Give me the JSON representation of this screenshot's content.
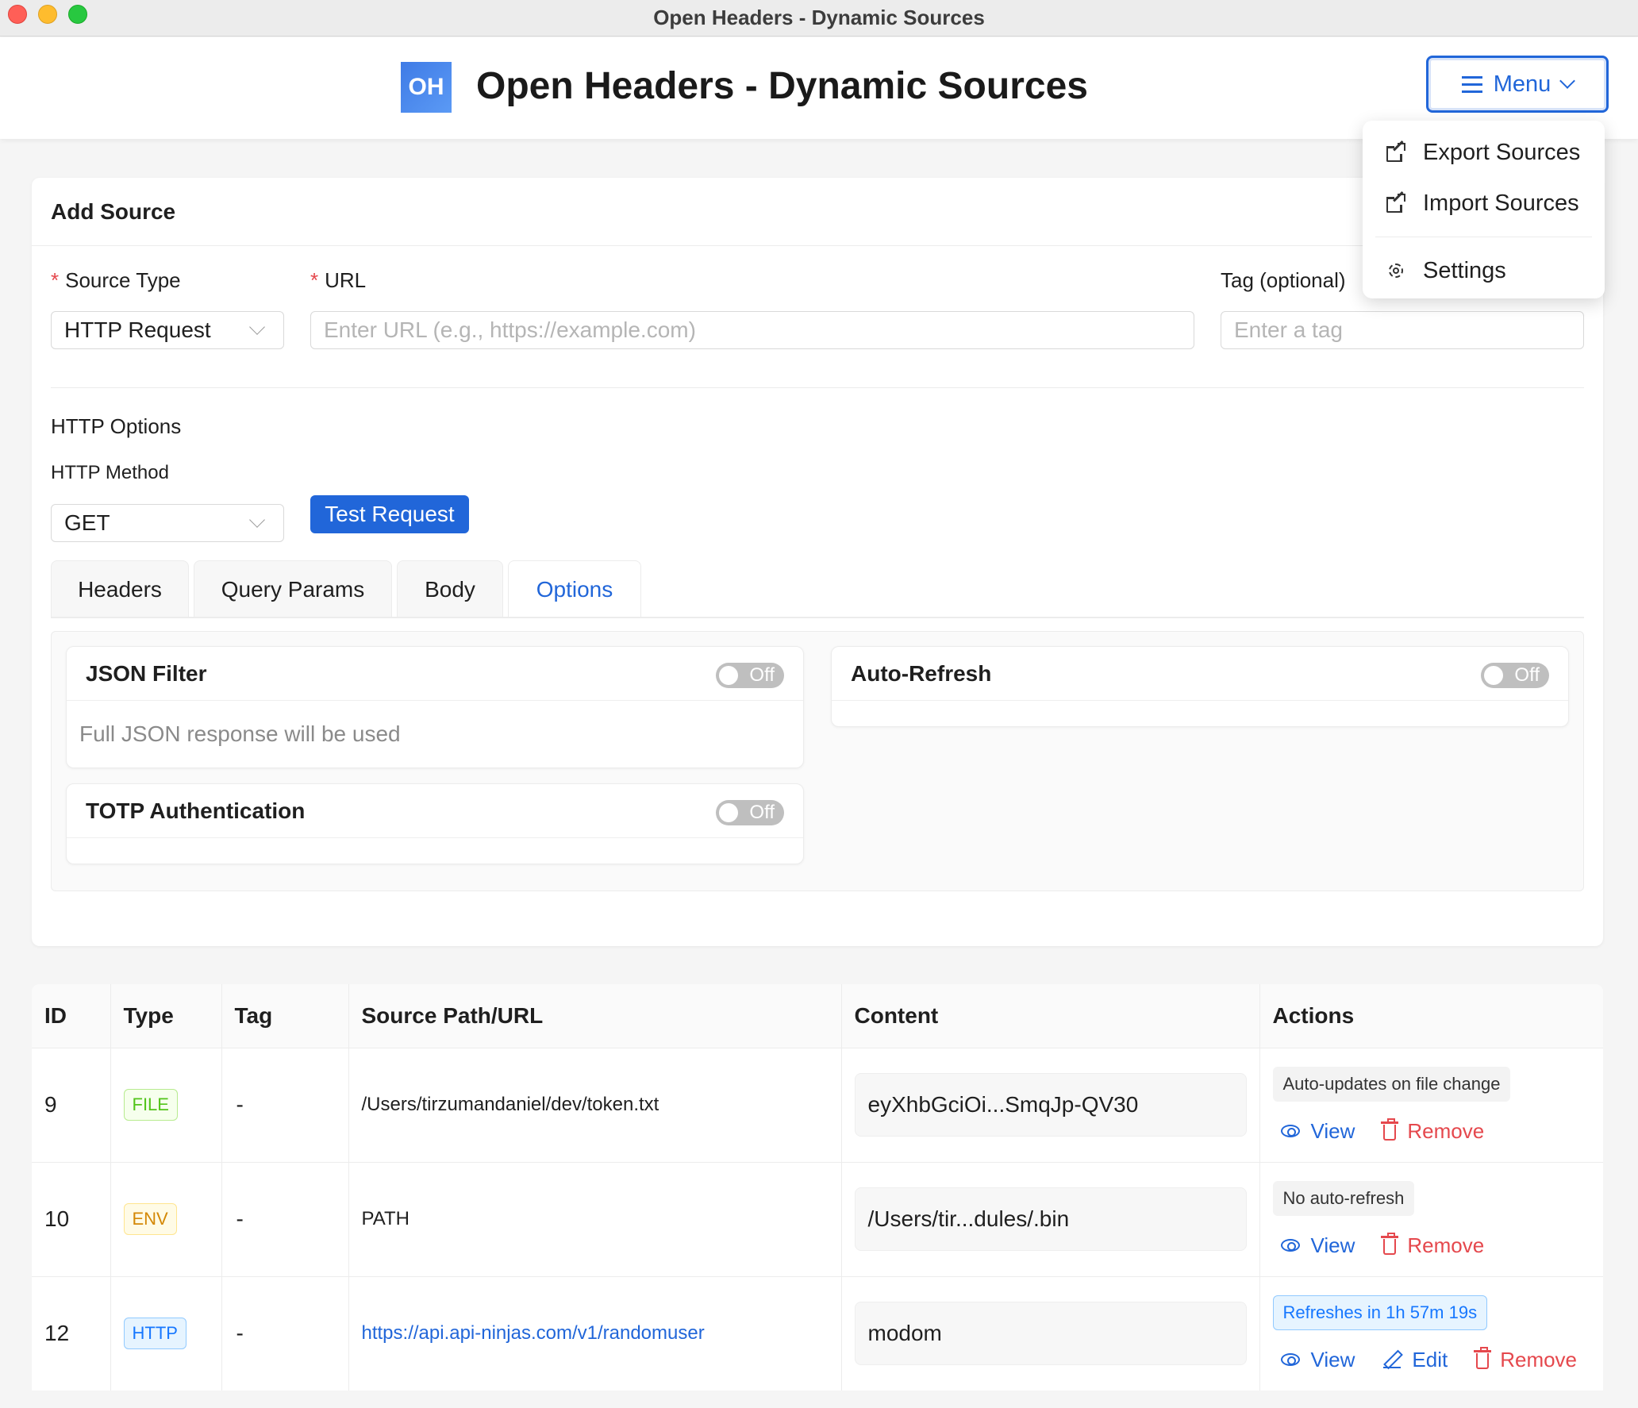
{
  "window": {
    "title": "Open Headers - Dynamic Sources"
  },
  "header": {
    "logo_text": "OH",
    "title": "Open Headers - Dynamic Sources",
    "menu_label": "Menu"
  },
  "menu_dropdown": {
    "items": [
      {
        "label": "Export Sources",
        "icon": "export-icon"
      },
      {
        "label": "Import Sources",
        "icon": "import-icon"
      },
      {
        "label": "Settings",
        "icon": "gear-icon"
      }
    ]
  },
  "add_source": {
    "title": "Add Source",
    "source_type_label": "Source Type",
    "source_type_value": "HTTP Request",
    "url_label": "URL",
    "url_placeholder": "Enter URL (e.g., https://example.com)",
    "tag_label": "Tag (optional)",
    "tag_placeholder": "Enter a tag",
    "http_options_label": "HTTP Options",
    "http_method_label": "HTTP Method",
    "http_method_value": "GET",
    "test_button": "Test Request",
    "tabs": [
      "Headers",
      "Query Params",
      "Body",
      "Options"
    ],
    "active_tab": "Options",
    "options": {
      "json_filter": {
        "title": "JSON Filter",
        "toggle": "Off",
        "note": "Full JSON response will be used"
      },
      "auto_refresh": {
        "title": "Auto-Refresh",
        "toggle": "Off"
      },
      "totp": {
        "title": "TOTP Authentication",
        "toggle": "Off"
      }
    }
  },
  "sources_table": {
    "columns": [
      "ID",
      "Type",
      "Tag",
      "Source Path/URL",
      "Content",
      "Actions"
    ],
    "rows": [
      {
        "id": "9",
        "type": "FILE",
        "tag": "-",
        "path": "/Users/tirzumandaniel/dev/token.txt",
        "content": "eyXhbGciOi...SmqJp-QV30",
        "status": "Auto-updates on file change",
        "view": "View",
        "remove": "Remove"
      },
      {
        "id": "10",
        "type": "ENV",
        "tag": "-",
        "path": "PATH",
        "content": "/Users/tir...dules/.bin",
        "status": "No auto-refresh",
        "view": "View",
        "remove": "Remove"
      },
      {
        "id": "12",
        "type": "HTTP",
        "tag": "-",
        "path": "https://api.api-ninjas.com/v1/randomuser",
        "content": "modom",
        "status": "Refreshes in 1h 57m 19s",
        "view": "View",
        "edit": "Edit",
        "remove": "Remove"
      }
    ]
  },
  "colors": {
    "accent": "#2166d9",
    "danger": "#e5484d",
    "file_tag": "#52c41a",
    "env_tag": "#d48806",
    "http_tag": "#1677ff"
  }
}
